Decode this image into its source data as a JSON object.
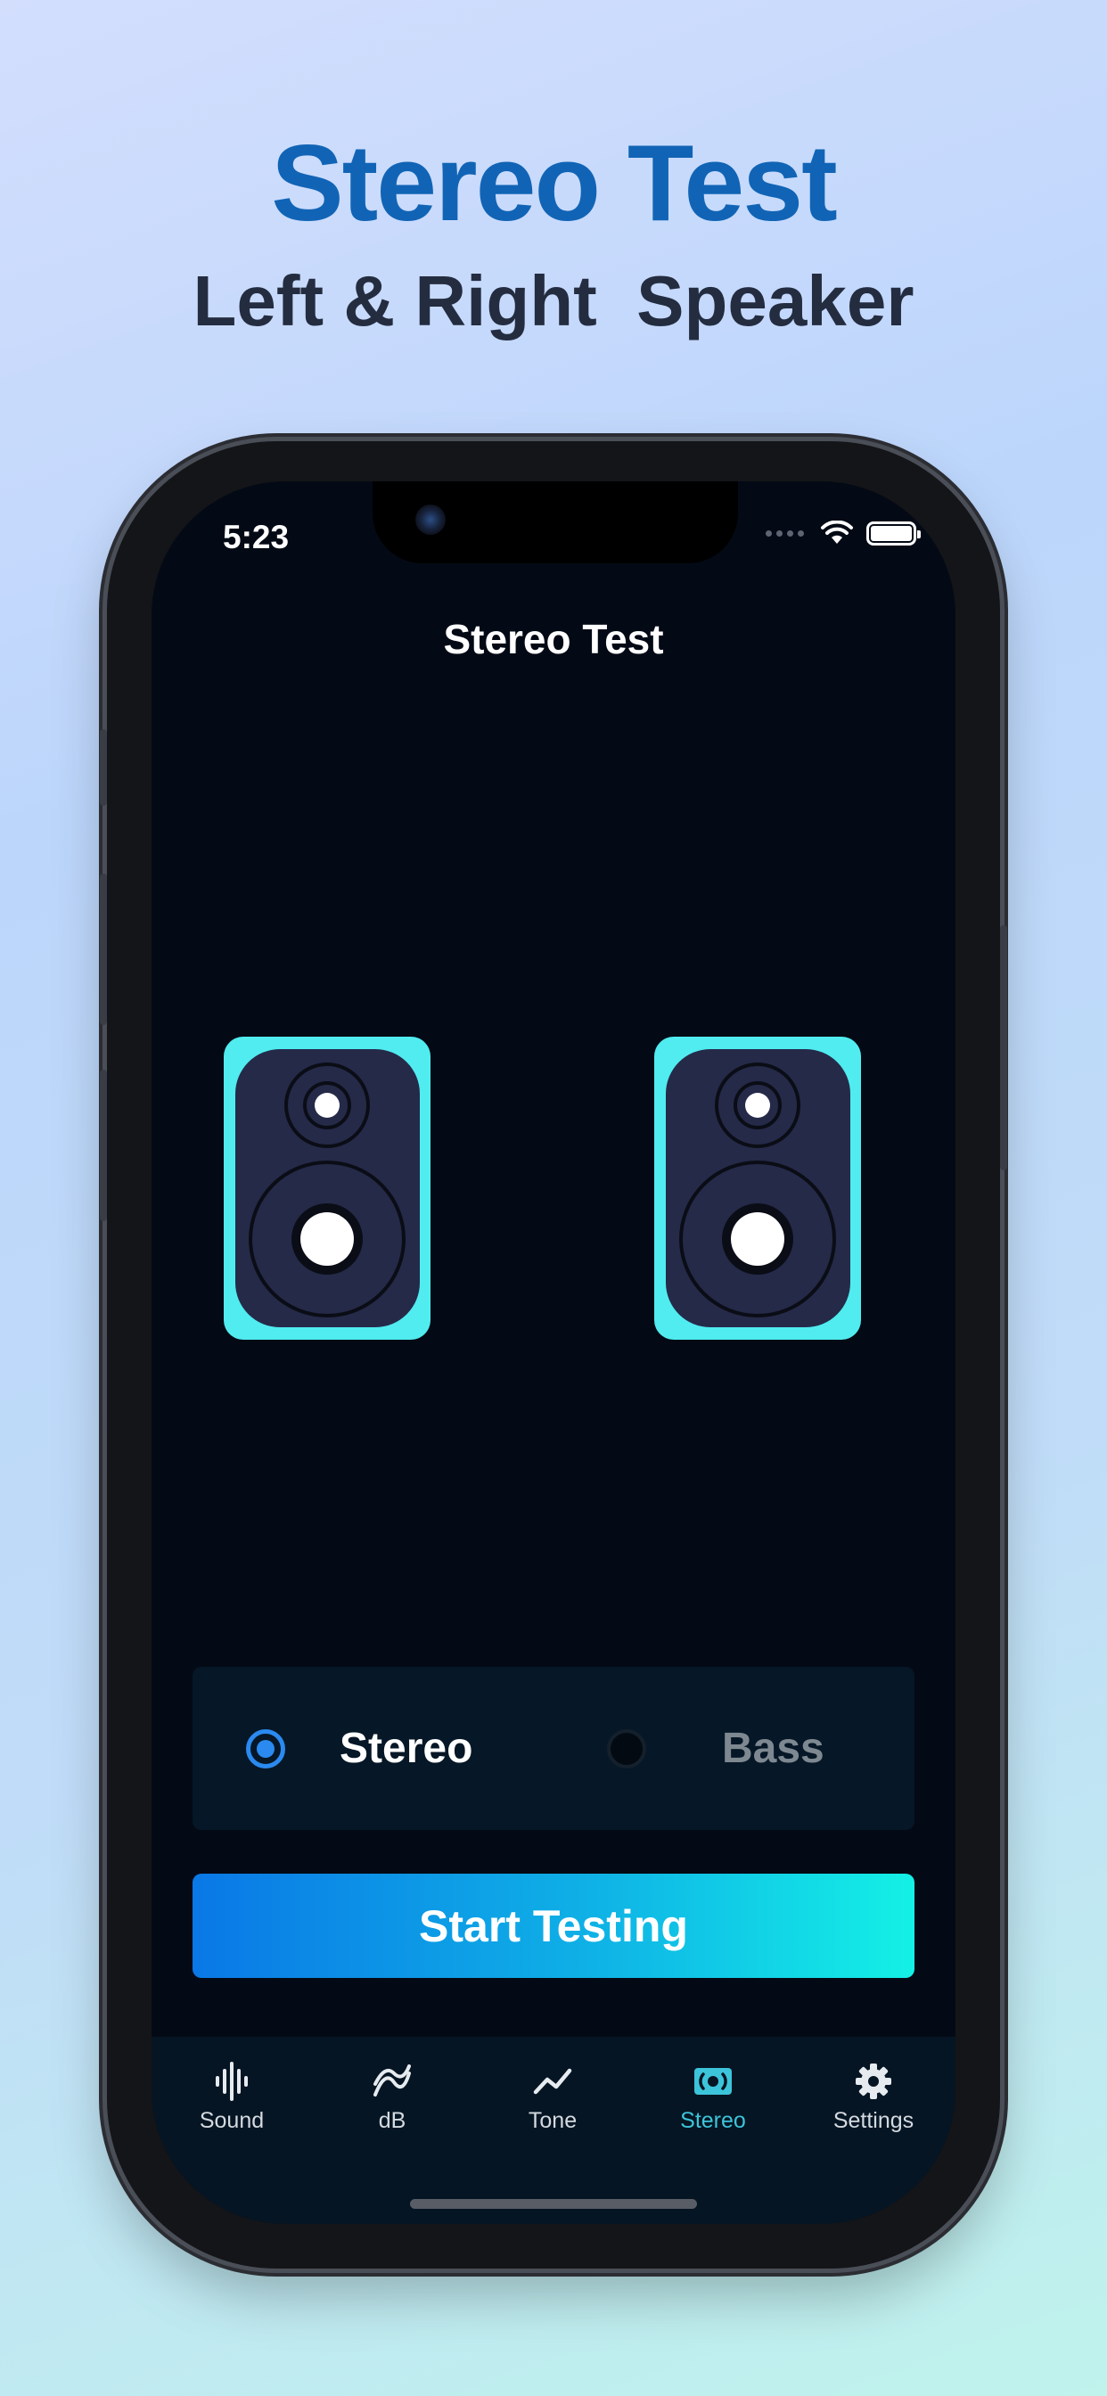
{
  "promo": {
    "title": "Stereo Test",
    "subtitle": "Left & Right  Speaker"
  },
  "status_bar": {
    "time": "5:23"
  },
  "app": {
    "title": "Stereo Test",
    "speakers": [
      "left-speaker",
      "right-speaker"
    ]
  },
  "mode_selector": {
    "options": [
      {
        "label": "Stereo",
        "selected": true
      },
      {
        "label": "Bass",
        "selected": false
      }
    ]
  },
  "start_button": {
    "label": "Start Testing"
  },
  "tabbar": {
    "active_index": 3,
    "tabs": [
      {
        "label": "Sound",
        "icon": "waveform-icon"
      },
      {
        "label": "dB",
        "icon": "decibel-icon"
      },
      {
        "label": "Tone",
        "icon": "tone-line-icon"
      },
      {
        "label": "Stereo",
        "icon": "stereo-speaker-icon"
      },
      {
        "label": "Settings",
        "icon": "gear-icon"
      }
    ]
  },
  "colors": {
    "accent": "#3cc4da",
    "speaker_frame": "#50ecf0",
    "speaker_body": "#252a49",
    "radio_selected": "#2a8af0"
  }
}
